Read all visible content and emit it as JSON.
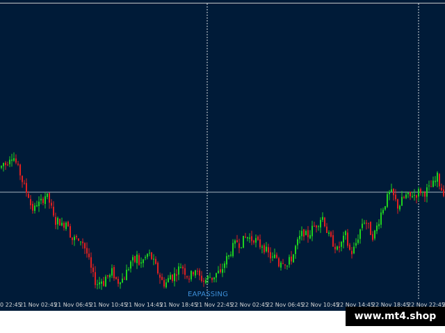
{
  "colors": {
    "background": "#001b38",
    "bull_candle": "#1fd21f",
    "bear_candle": "#e02020",
    "grid_dashed": "#ffffff",
    "price_line": "#aab4c0",
    "axis_text": "#d8d8d8",
    "indicator_text": "#3d8fd8",
    "watermark_bg": "#000000"
  },
  "indicator_label": "EAPASSING",
  "watermark": "www.mt4.shop",
  "time_axis": {
    "labels": [
      "0 22:45",
      "21 Nov 02:45",
      "21 Nov 06:45",
      "21 Nov 10:45",
      "21 Nov 14:45",
      "21 Nov 18:45",
      "21 Nov 22:45",
      "22 Nov 02:45",
      "22 Nov 06:45",
      "22 Nov 10:45",
      "22 Nov 14:45",
      "22 Nov 18:45",
      "22 Nov 22:45",
      "2"
    ]
  },
  "chart_data": {
    "type": "candlestick",
    "note_units": "relative price level, higher is up",
    "horizontal_line": 62,
    "period_separators_after_label": [
      "21 Nov 22:45",
      "22 Nov 22:45"
    ],
    "close_path": [
      [
        0,
        78
      ],
      [
        4,
        81
      ],
      [
        8,
        80
      ],
      [
        12,
        85
      ],
      [
        16,
        86
      ],
      [
        20,
        84
      ],
      [
        24,
        78
      ],
      [
        28,
        74
      ],
      [
        32,
        68
      ],
      [
        36,
        63
      ],
      [
        40,
        60
      ],
      [
        44,
        52
      ],
      [
        48,
        50
      ],
      [
        52,
        55
      ],
      [
        56,
        54
      ],
      [
        60,
        57
      ],
      [
        64,
        60
      ],
      [
        68,
        58
      ],
      [
        72,
        53
      ],
      [
        76,
        45
      ],
      [
        80,
        42
      ],
      [
        84,
        44
      ],
      [
        88,
        40
      ],
      [
        92,
        42
      ],
      [
        96,
        44
      ],
      [
        100,
        35
      ],
      [
        104,
        30
      ],
      [
        108,
        33
      ],
      [
        112,
        28
      ],
      [
        116,
        32
      ],
      [
        120,
        27
      ],
      [
        124,
        22
      ],
      [
        128,
        15
      ],
      [
        132,
        8
      ],
      [
        136,
        4
      ],
      [
        140,
        2
      ],
      [
        144,
        5
      ],
      [
        148,
        3
      ],
      [
        152,
        8
      ],
      [
        156,
        6
      ],
      [
        160,
        10
      ],
      [
        164,
        7
      ],
      [
        168,
        3
      ],
      [
        172,
        6
      ],
      [
        176,
        5
      ],
      [
        180,
        9
      ],
      [
        184,
        13
      ],
      [
        188,
        18
      ],
      [
        192,
        16
      ],
      [
        196,
        20
      ],
      [
        200,
        14
      ],
      [
        204,
        17
      ],
      [
        208,
        19
      ],
      [
        212,
        22
      ],
      [
        216,
        20
      ],
      [
        220,
        16
      ],
      [
        224,
        12
      ],
      [
        228,
        8
      ],
      [
        232,
        4
      ],
      [
        236,
        2
      ],
      [
        240,
        4
      ],
      [
        244,
        8
      ],
      [
        248,
        6
      ],
      [
        252,
        10
      ],
      [
        256,
        12
      ],
      [
        260,
        15
      ],
      [
        264,
        11
      ],
      [
        268,
        8
      ],
      [
        272,
        6
      ],
      [
        276,
        10
      ],
      [
        280,
        12
      ],
      [
        284,
        7
      ],
      [
        288,
        6
      ],
      [
        292,
        4
      ],
      [
        296,
        5
      ],
      [
        300,
        7
      ],
      [
        304,
        6
      ],
      [
        308,
        8
      ],
      [
        312,
        10
      ],
      [
        316,
        8
      ],
      [
        320,
        14
      ],
      [
        324,
        18
      ],
      [
        328,
        20
      ],
      [
        332,
        25
      ],
      [
        336,
        27
      ],
      [
        340,
        30
      ],
      [
        344,
        28
      ],
      [
        348,
        30
      ],
      [
        352,
        32
      ],
      [
        356,
        33
      ],
      [
        360,
        31
      ],
      [
        364,
        32
      ],
      [
        368,
        30
      ],
      [
        372,
        27
      ],
      [
        376,
        28
      ],
      [
        380,
        25
      ],
      [
        384,
        22
      ],
      [
        388,
        20
      ],
      [
        392,
        18
      ],
      [
        396,
        21
      ],
      [
        400,
        15
      ],
      [
        404,
        19
      ],
      [
        408,
        17
      ],
      [
        412,
        14
      ],
      [
        416,
        18
      ],
      [
        420,
        20
      ],
      [
        424,
        26
      ],
      [
        428,
        30
      ],
      [
        432,
        34
      ],
      [
        436,
        36
      ],
      [
        440,
        33
      ],
      [
        444,
        35
      ],
      [
        448,
        38
      ],
      [
        452,
        40
      ],
      [
        456,
        42
      ],
      [
        460,
        45
      ],
      [
        464,
        46
      ],
      [
        468,
        38
      ],
      [
        472,
        33
      ],
      [
        476,
        30
      ],
      [
        480,
        28
      ],
      [
        484,
        24
      ],
      [
        488,
        27
      ],
      [
        492,
        30
      ],
      [
        496,
        34
      ],
      [
        500,
        26
      ],
      [
        504,
        22
      ],
      [
        508,
        25
      ],
      [
        512,
        30
      ],
      [
        516,
        36
      ],
      [
        520,
        42
      ],
      [
        524,
        44
      ],
      [
        528,
        40
      ],
      [
        532,
        36
      ],
      [
        536,
        33
      ],
      [
        540,
        38
      ],
      [
        544,
        44
      ],
      [
        548,
        50
      ],
      [
        552,
        54
      ],
      [
        556,
        58
      ],
      [
        560,
        62
      ],
      [
        564,
        60
      ],
      [
        568,
        56
      ],
      [
        572,
        52
      ],
      [
        576,
        56
      ],
      [
        580,
        58
      ],
      [
        584,
        60
      ],
      [
        588,
        58
      ],
      [
        592,
        61
      ],
      [
        596,
        60
      ],
      [
        600,
        62
      ],
      [
        604,
        63
      ],
      [
        608,
        61
      ],
      [
        612,
        63
      ],
      [
        616,
        64
      ],
      [
        620,
        66
      ],
      [
        624,
        68
      ],
      [
        628,
        72
      ],
      [
        632,
        66
      ],
      [
        636,
        62
      ],
      [
        640,
        63
      ]
    ],
    "ylim": [
      -5,
      115
    ]
  }
}
